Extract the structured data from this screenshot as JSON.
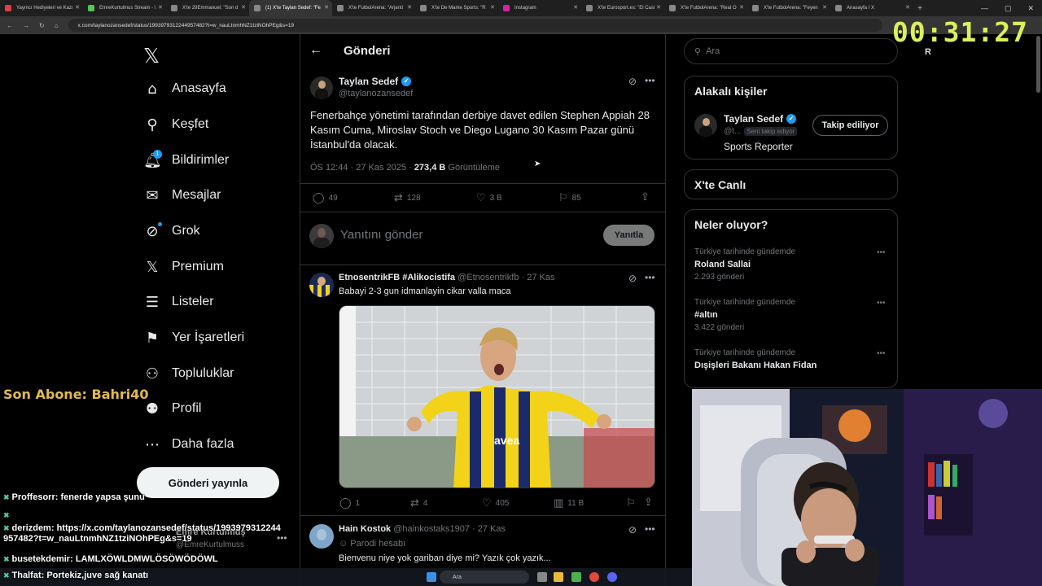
{
  "browser": {
    "tabs": [
      {
        "label": "Yayıncı Hediyeleri ve Kazı",
        "active": false,
        "color": "#e04040"
      },
      {
        "label": "EmreKurtulmus Stream - \\",
        "active": false,
        "color": "#53c653"
      },
      {
        "label": "X'te 29Emmanuel: \"Son d",
        "active": false,
        "color": "#888888"
      },
      {
        "label": "(1) X'te Taylan Sedef: \"Fe",
        "active": true,
        "color": "#888888"
      },
      {
        "label": "X'te FutbolArena: \"Arjanti",
        "active": false,
        "color": "#888888"
      },
      {
        "label": "X'te De Marke Sports: \"R",
        "active": false,
        "color": "#888888"
      },
      {
        "label": "Instagram",
        "active": false,
        "color": "#d6249f"
      },
      {
        "label": "X'te Eurosport.es: \"El Casi",
        "active": false,
        "color": "#888888"
      },
      {
        "label": "X'te FutbolArena: \"Real O",
        "active": false,
        "color": "#888888"
      },
      {
        "label": "X'te FutbolArena: \"Feyen",
        "active": false,
        "color": "#888888"
      },
      {
        "label": "Anasayfa / X",
        "active": false,
        "color": "#888888"
      }
    ],
    "url": "x.com/taylanozansedef/status/1993979312244957482?t=w_nauLtnmhNZ1tziNOhPEg&s=19"
  },
  "timer": "00:31:27",
  "nav": {
    "items": [
      {
        "label": "Anasayfa",
        "icon": "home-icon",
        "glyph": "⌂"
      },
      {
        "label": "Keşfet",
        "icon": "search-icon",
        "glyph": "⚲"
      },
      {
        "label": "Bildirimler",
        "icon": "bell-icon",
        "glyph": "🔔︎"
      },
      {
        "label": "Mesajlar",
        "icon": "mail-icon",
        "glyph": "✉"
      },
      {
        "label": "Grok",
        "icon": "grok-icon",
        "glyph": "⊘"
      },
      {
        "label": "Premium",
        "icon": "x-premium-icon",
        "glyph": "𝕏"
      },
      {
        "label": "Listeler",
        "icon": "list-icon",
        "glyph": "☰"
      },
      {
        "label": "Yer İşaretleri",
        "icon": "bookmark-icon",
        "glyph": "⚑"
      },
      {
        "label": "Topluluklar",
        "icon": "communities-icon",
        "glyph": "⚇"
      },
      {
        "label": "Profil",
        "icon": "profile-icon",
        "glyph": "⚉"
      },
      {
        "label": "Daha fazla",
        "icon": "more-circle-icon",
        "glyph": "⋯"
      }
    ],
    "notifications_badge": "1",
    "post_button": "Gönderi yayınla",
    "account_name": "Emre Kurtulmuş",
    "account_handle": "@EmreKurtulmuss"
  },
  "overlay": {
    "son_abone": "Son Abone: Bahri40",
    "chat": [
      {
        "user": "Proffesorr",
        "text": "fenerde yapsa şunu"
      },
      {
        "user": "",
        "text": ""
      },
      {
        "user": "derizdem",
        "text": "https://x.com/taylanozansedef/status/1993979312244957482?t=w_nauLtnmhNZ1tziNOhPEg&s=19"
      },
      {
        "user": "busetekdemir",
        "text": "LAMLXÖWLDMWLÖSÖWÖDÖWL"
      },
      {
        "user": "Thalfat",
        "text": "Portekiz,juve sağ kanatı"
      }
    ]
  },
  "page": {
    "title": "Gönderi"
  },
  "tweet": {
    "author": "Taylan Sedef",
    "handle": "@taylanozansedef",
    "text": "Fenerbahçe yönetimi tarafından derbiye davet edilen Stephen Appiah 28 Kasım Cuma, Miroslav Stoch ve Diego Lugano 30 Kasım Pazar günü İstanbul'da olacak.",
    "time": "ÖS 12:44 · 27 Kas 2025 · ",
    "views": "273,4 B",
    "views_label": " Görüntüleme",
    "replies": "49",
    "retweets": "128",
    "likes": "3 B",
    "bookmarks": "85",
    "reply_placeholder": "Yanıtını gönder",
    "reply_button": "Yanıtla"
  },
  "replies": [
    {
      "author": "EtnosentrikFB #Alikocistifa",
      "handle": "@Etnosentrikfb · 27 Kas",
      "text": "Babayi 2-3 gun idmanlayin cikar valla maca",
      "replies": "1",
      "retweets": "4",
      "likes": "405",
      "views": "11 B"
    },
    {
      "author": "Hain Kostok",
      "handle": "@hainkostaks1907 · 27 Kas",
      "label": "Parodi hesabı",
      "text": "Bienvenu niye yok gariban diye mi? Yazık çok yazık..."
    }
  ],
  "sidebar": {
    "search_placeholder": "Ara",
    "related_title": "Alakalı kişiler",
    "related": {
      "name": "Taylan Sedef",
      "handle": "@t...",
      "follows_you": "Seni takip ediyor",
      "bio": "Sports Reporter",
      "button": "Takip ediliyor"
    },
    "live_title": "X'te Canlı",
    "trends_title": "Neler oluyor?",
    "trends": [
      {
        "category": "Türkiye tarihinde gündemde",
        "name": "Roland Sallai",
        "count": "2.293 gönderi"
      },
      {
        "category": "Türkiye tarihinde gündemde",
        "name": "#altın",
        "count": "3.422 gönderi"
      },
      {
        "category": "Türkiye tarihinde gündemde",
        "name": "Dışişleri Bakanı Hakan Fidan",
        "count": ""
      }
    ],
    "side_letter": "R"
  },
  "taskbar": {
    "search": "Ara"
  },
  "colors": {
    "accent": "#1d9bf0",
    "timer": "#dcf05a",
    "son_abone": "#e2b94e"
  }
}
